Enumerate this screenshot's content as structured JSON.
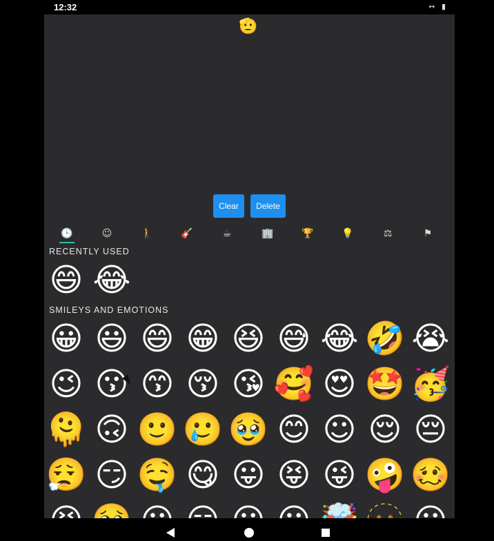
{
  "status_bar": {
    "time": "12:32",
    "icons": [
      "↔",
      "▮"
    ]
  },
  "selected": "🫡",
  "buttons": {
    "clear": "Clear",
    "delete": "Delete"
  },
  "tabs": [
    "🕒",
    "☺",
    "🚶",
    "🎸",
    "☕",
    "🏢",
    "🏆",
    "💡",
    "⚖",
    "⚑"
  ],
  "sections": {
    "recent": "RECENTLY USED",
    "smileys": "SMILEYS AND EMOTIONS"
  },
  "recent_emojis": [
    "😄",
    "😂"
  ],
  "smiley_emojis": [
    "😀",
    "😃",
    "😄",
    "😁",
    "😆",
    "😅",
    "😂",
    "🤣",
    "😭",
    "😉",
    "😗",
    "😙",
    "😚",
    "😘",
    "🥰",
    "😍",
    "🤩",
    "🥳",
    "🫠",
    "🙃",
    "🙂",
    "🥲",
    "🥹",
    "😊",
    "☺",
    "😌",
    "😔",
    "😮‍💨",
    "😏",
    "🤤",
    "😋",
    "😛",
    "😝",
    "😜",
    "🤪",
    "🥴",
    "😣",
    "🥺",
    "😶",
    "😑",
    "😶",
    "😶",
    "🤯",
    "🫥",
    "😐"
  ]
}
